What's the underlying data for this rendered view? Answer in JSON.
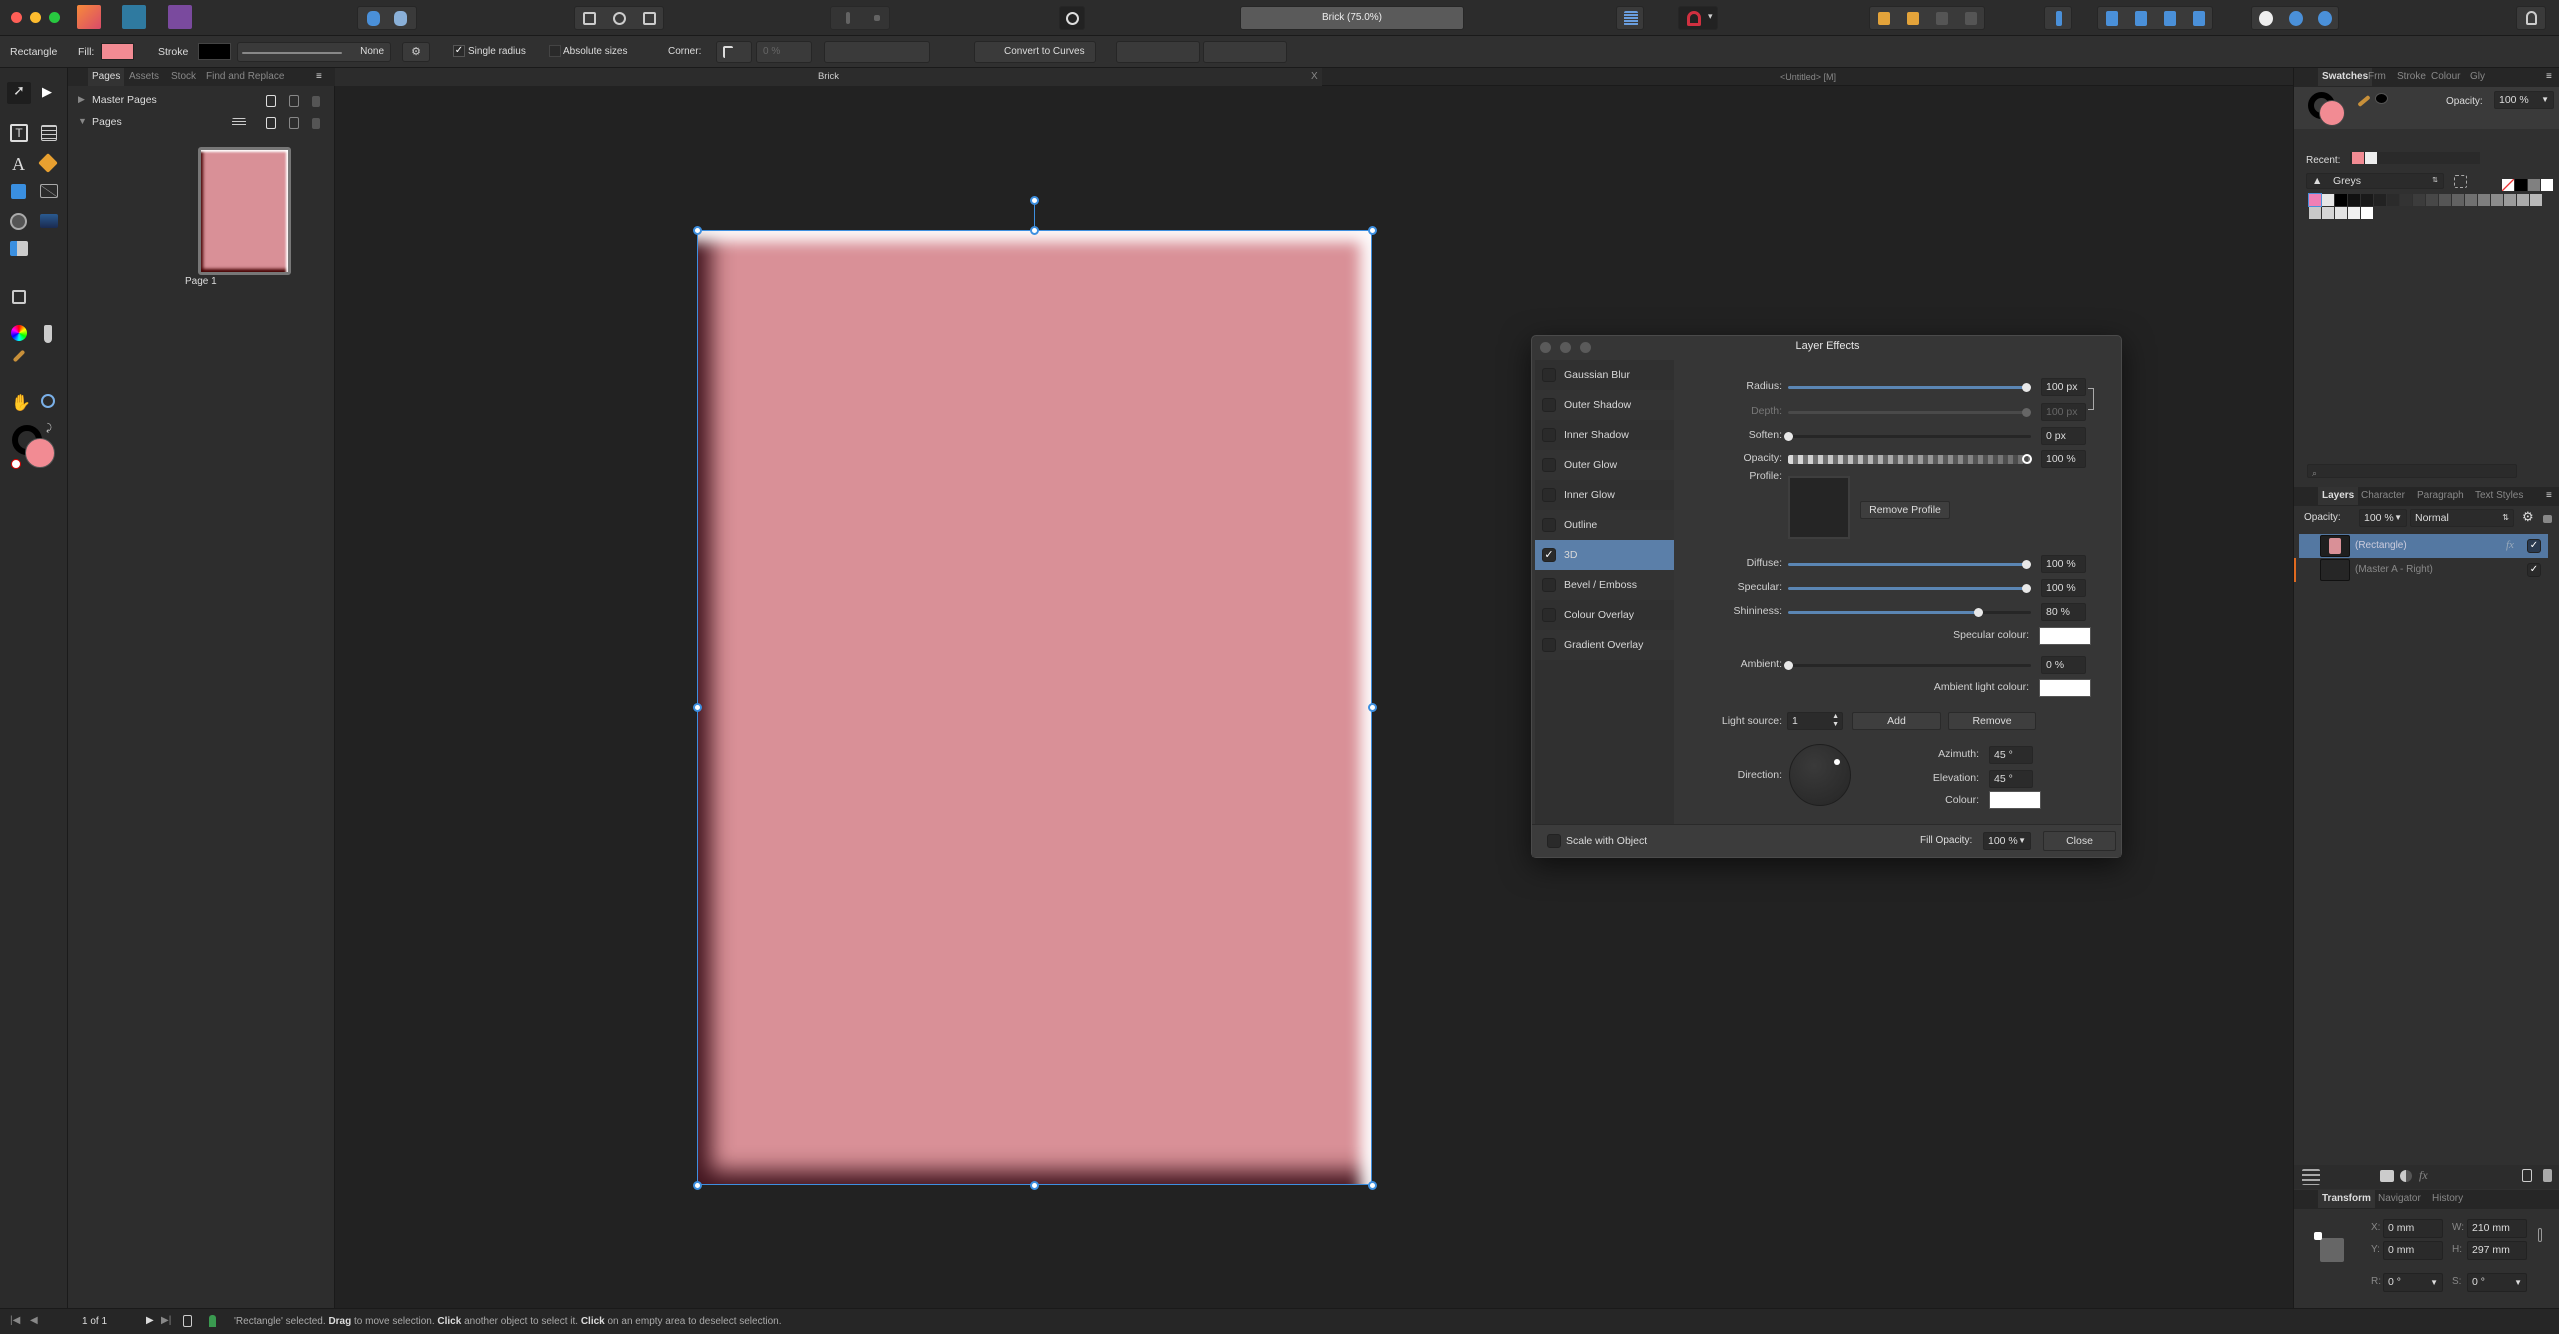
{
  "topbar": {
    "doc_zoom": "Brick (75.0%)"
  },
  "context": {
    "tool": "Rectangle",
    "fill_label": "Fill:",
    "fill_color": "#f28b93",
    "stroke_label": "Stroke",
    "stroke_color": "#000000",
    "stroke_style": "None",
    "single_radius": "Single radius",
    "absolute_sizes": "Absolute sizes",
    "corner_label": "Corner:",
    "corner_value": "0 %",
    "convert": "Convert to Curves"
  },
  "pages_panel": {
    "tabs": [
      "Pages",
      "Assets",
      "Stock",
      "Find and Replace"
    ],
    "master_pages": "Master Pages",
    "pages": "Pages",
    "page_label": "Page 1"
  },
  "doc_tabs": {
    "active": "Brick",
    "other": "<Untitled> [M]",
    "close": "X"
  },
  "dialog": {
    "title": "Layer Effects",
    "effects": [
      {
        "label": "Gaussian Blur",
        "checked": false
      },
      {
        "label": "Outer Shadow",
        "checked": false
      },
      {
        "label": "Inner Shadow",
        "checked": false
      },
      {
        "label": "Outer Glow",
        "checked": false
      },
      {
        "label": "Inner Glow",
        "checked": false
      },
      {
        "label": "Outline",
        "checked": false
      },
      {
        "label": "3D",
        "checked": true
      },
      {
        "label": "Bevel / Emboss",
        "checked": false
      },
      {
        "label": "Colour Overlay",
        "checked": false
      },
      {
        "label": "Gradient Overlay",
        "checked": false
      }
    ],
    "check_mark": "✓",
    "radius": {
      "label": "Radius:",
      "value": "100 px",
      "level": 1.0
    },
    "depth": {
      "label": "Depth:",
      "value": "100 px",
      "level": 1.0
    },
    "soften": {
      "label": "Soften:",
      "value": "0 px",
      "level": 0
    },
    "opacity": {
      "label": "Opacity:",
      "value": "100 %",
      "level": 1.0
    },
    "profile": {
      "label": "Profile:",
      "remove": "Remove Profile"
    },
    "diffuse": {
      "label": "Diffuse:",
      "value": "100 %",
      "level": 1.0
    },
    "specular": {
      "label": "Specular:",
      "value": "100 %",
      "level": 1.0
    },
    "shininess": {
      "label": "Shininess:",
      "value": "80 %",
      "level": 0.8
    },
    "specular_colour": {
      "label": "Specular colour:",
      "color": "#ffffff"
    },
    "ambient": {
      "label": "Ambient:",
      "value": "0 %",
      "level": 0
    },
    "ambient_colour": {
      "label": "Ambient light colour:",
      "color": "#ffffff"
    },
    "light_source": {
      "label": "Light source:",
      "value": "1",
      "add": "Add",
      "remove": "Remove"
    },
    "direction": {
      "label": "Direction:"
    },
    "azimuth": {
      "label": "Azimuth:",
      "value": "45 °"
    },
    "elevation": {
      "label": "Elevation:",
      "value": "45 °"
    },
    "colour": {
      "label": "Colour:",
      "color": "#ffffff"
    },
    "scale_with_object": "Scale with Object",
    "fill_opacity": {
      "label": "Fill Opacity:",
      "value": "100 %"
    },
    "close": "Close"
  },
  "swatches": {
    "tabs": [
      "Swatches",
      "Frm",
      "Stroke",
      "Colour",
      "Gly"
    ],
    "opacity_label": "Opacity:",
    "opacity": "100 %",
    "recent_label": "Recent:",
    "recent": [
      "#f28b93",
      "#eeeeee"
    ],
    "palette": "Greys",
    "grid": [
      "#f07fb5",
      "#e6e6e6",
      "#000000",
      "#111111",
      "#1a1a1a",
      "#222222",
      "#2b2b2b",
      "#333333",
      "#3c3c3c",
      "#474747",
      "#555555",
      "#626262",
      "#707070",
      "#7e7e7e",
      "#8c8c8c",
      "#9b9b9b",
      "#aaaaaa",
      "#b9b9b9",
      "#c8c8c8",
      "#d6d6d6",
      "#e4e4e4",
      "#f0f0f0",
      "#ffffff"
    ]
  },
  "layers": {
    "tabs": [
      "Layers",
      "Character",
      "Paragraph",
      "Text Styles"
    ],
    "opacity_label": "Opacity:",
    "opacity": "100 %",
    "blend": "Normal",
    "items": [
      {
        "name": "(Rectangle)",
        "selected": true,
        "fx": "fx"
      },
      {
        "name": "(Master A - Right)",
        "selected": false
      }
    ]
  },
  "transform": {
    "tabs": [
      "Transform",
      "Navigator",
      "History"
    ],
    "x_label": "X:",
    "x": "0 mm",
    "y_label": "Y:",
    "y": "0 mm",
    "w_label": "W:",
    "w": "210 mm",
    "h_label": "H:",
    "h": "297 mm",
    "r_label": "R:",
    "r": "0 °",
    "s_label": "S:",
    "s": "0 °"
  },
  "status": {
    "page": "1 of 1",
    "msg_a": "'Rectangle' selected. ",
    "b1": "Drag",
    "msg_b": " to move selection. ",
    "b2": "Click",
    "msg_c": " another object to select it. ",
    "b3": "Click",
    "msg_d": " on an empty area to deselect selection."
  }
}
